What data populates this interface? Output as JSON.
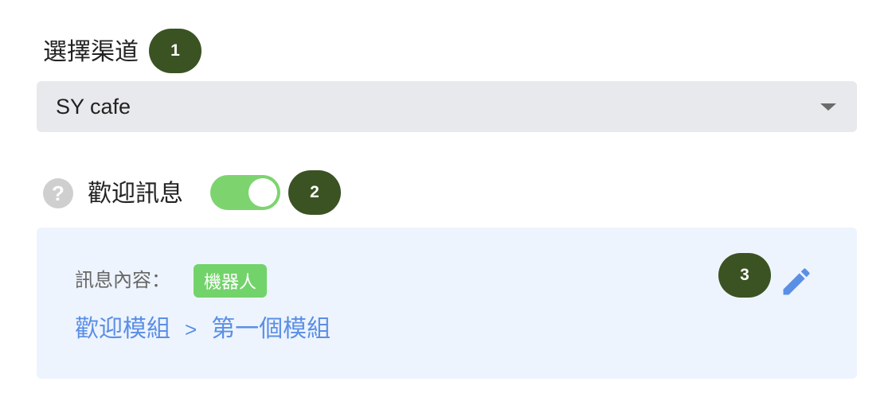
{
  "channel": {
    "label": "選擇渠道",
    "step": "1",
    "selected_value": "SY cafe"
  },
  "welcome": {
    "help_icon_glyph": "?",
    "label": "歡迎訊息",
    "toggle_on": true,
    "step": "2"
  },
  "content": {
    "label": "訊息內容：",
    "tag": "機器人",
    "step": "3",
    "breadcrumb": {
      "module": "歡迎模組",
      "separator": ">",
      "submodule": "第一個模組"
    }
  },
  "colors": {
    "badge": "#3b5323",
    "toggle": "#7dd46f",
    "tag": "#72d36a",
    "link": "#5b8fe6",
    "panel": "#eef4fd"
  },
  "icons": {
    "dropdown": "caret-down-icon",
    "help": "help-icon",
    "edit": "pencil-icon"
  }
}
